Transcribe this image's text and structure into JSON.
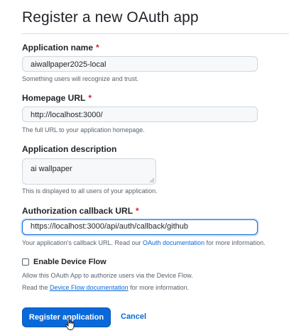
{
  "page": {
    "title": "Register a new OAuth app"
  },
  "fields": {
    "app_name": {
      "label": "Application name",
      "required_mark": "*",
      "value": "aiwallpaper2025-local",
      "note": "Something users will recognize and trust."
    },
    "homepage": {
      "label": "Homepage URL",
      "required_mark": "*",
      "value": "http://localhost:3000/",
      "note": "The full URL to your application homepage."
    },
    "description": {
      "label": "Application description",
      "value": "ai wallpaper",
      "note": "This is displayed to all users of your application."
    },
    "callback": {
      "label": "Authorization callback URL",
      "required_mark": "*",
      "value": "https://localhost:3000/api/auth/callback/github",
      "note_prefix": "Your application's callback URL. Read our ",
      "note_link": "OAuth documentation",
      "note_suffix": " for more information."
    }
  },
  "device_flow": {
    "label": "Enable Device Flow",
    "checked": false,
    "note1": "Allow this OAuth App to authorize users via the Device Flow.",
    "note2_prefix": "Read the ",
    "note2_link": "Device Flow documentation",
    "note2_suffix": " for more information."
  },
  "actions": {
    "register_label": "Register application",
    "cancel_label": "Cancel"
  },
  "colors": {
    "accent": "#0969da",
    "required": "#cf222e",
    "muted_text": "#59636e",
    "input_bg": "#f6f8fa"
  }
}
